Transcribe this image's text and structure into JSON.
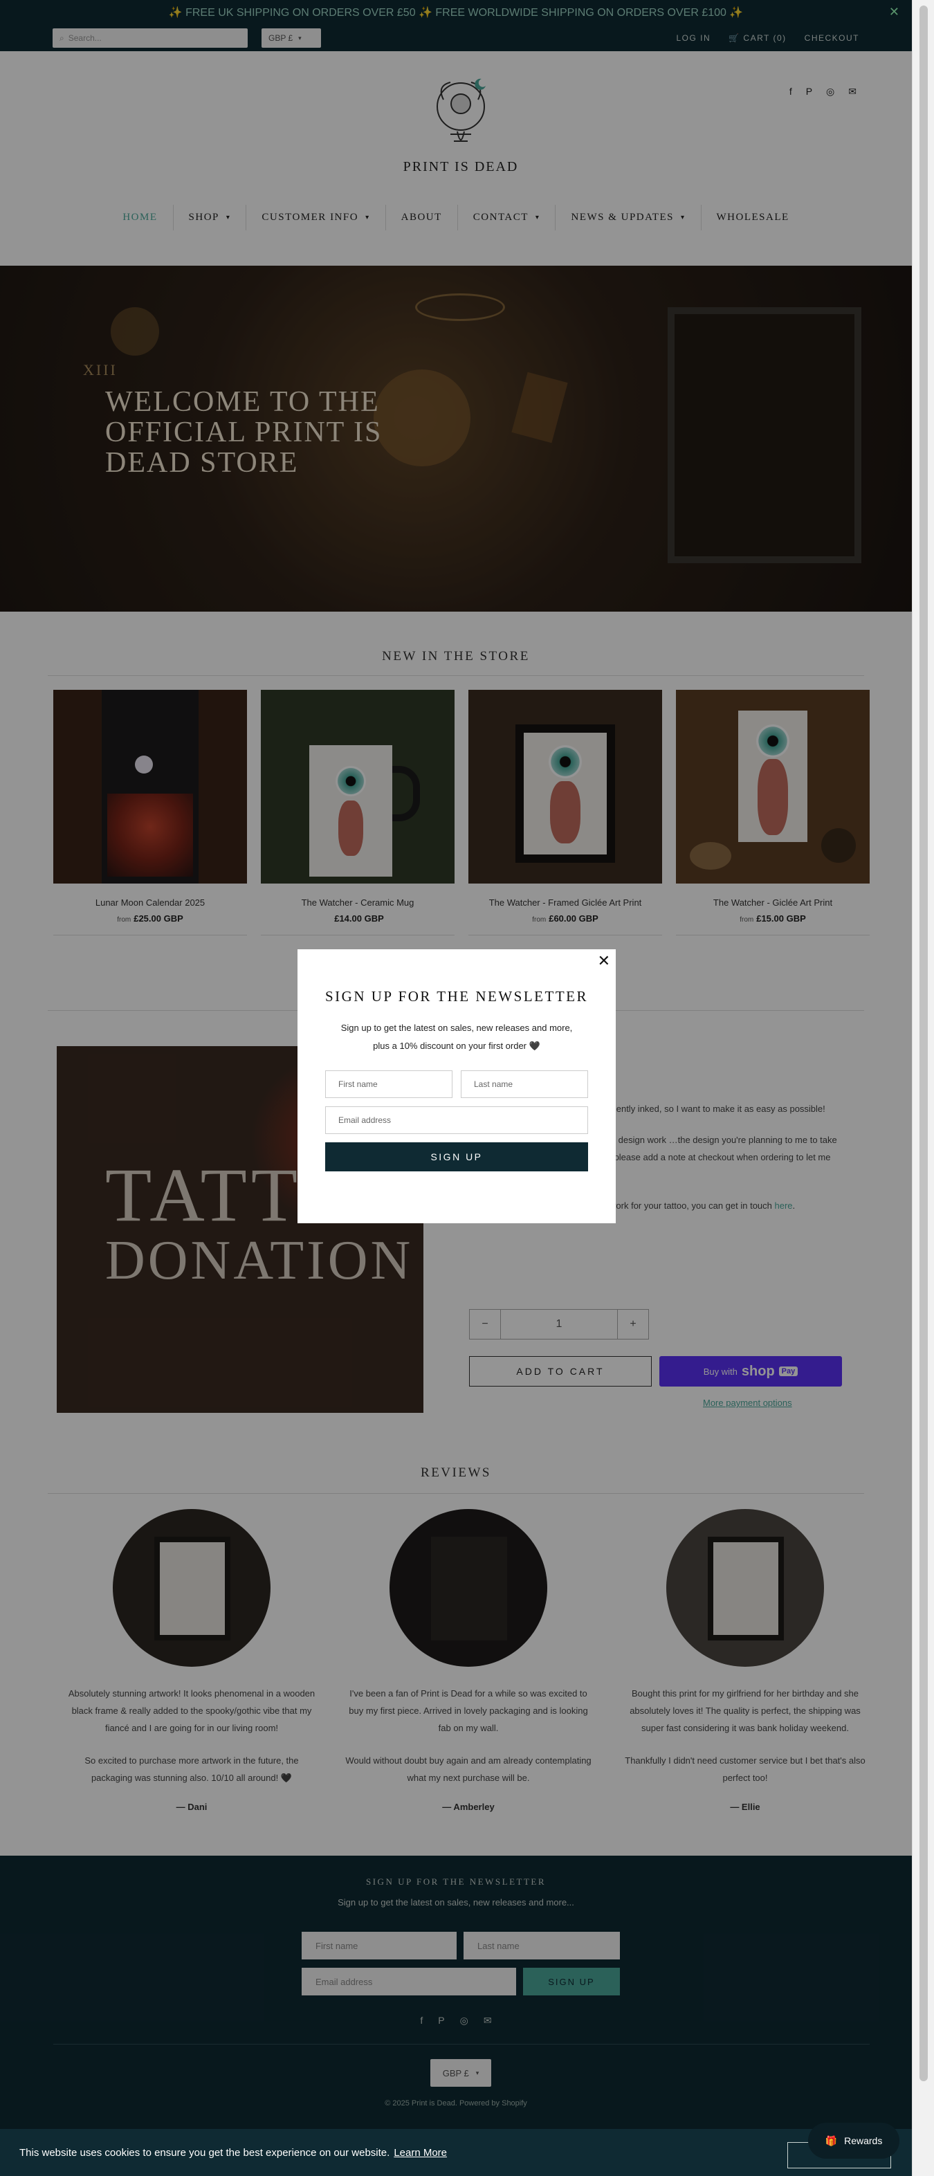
{
  "announcement": {
    "text": "✨ FREE UK SHIPPING ON ORDERS OVER £50 ✨ FREE WORLDWIDE SHIPPING ON ORDERS OVER £100 ✨",
    "close": "✕"
  },
  "topbar": {
    "search_placeholder": "Search...",
    "currency": "GBP £",
    "login": "LOG IN",
    "cart": "CART (0)",
    "checkout": "CHECKOUT"
  },
  "header": {
    "logo_text": "PRINT IS DEAD"
  },
  "nav": [
    {
      "label": "HOME"
    },
    {
      "label": "SHOP"
    },
    {
      "label": "CUSTOMER INFO"
    },
    {
      "label": "ABOUT"
    },
    {
      "label": "CONTACT"
    },
    {
      "label": "NEWS & UPDATES"
    },
    {
      "label": "WHOLESALE"
    }
  ],
  "hero": {
    "roman": "XIII",
    "title": "WELCOME TO THE OFFICIAL PRINT IS DEAD STORE"
  },
  "new_in_store": {
    "title": "NEW IN THE STORE",
    "products": [
      {
        "name": "Lunar Moon Calendar 2025",
        "from": "from",
        "price": "£25.00 GBP"
      },
      {
        "name": "The Watcher - Ceramic Mug",
        "from": "",
        "price": "£14.00 GBP"
      },
      {
        "name": "The Watcher - Framed Giclée Art Print",
        "from": "from",
        "price": "£60.00 GBP"
      },
      {
        "name": "The Watcher - Giclée Art Print",
        "from": "from",
        "price": "£15.00 GBP"
      }
    ]
  },
  "featured": {
    "image_text_1": "TATTOO",
    "image_text_2": "DONATION",
    "p1": "if it's possible to get my work permanently inked, so I want to make it as easy as possible!",
    "p2": "…and doesn't come with any custom design work …the design you're planning to me to take with you to your tattoo appointment, please add a note at checkout when ordering to let me know what design you have chosen.",
    "p3_prefix": "If you would like to discuss custom work for your tattoo, you can get in touch",
    "p3_link": "here",
    "qty_minus": "−",
    "qty_value": "1",
    "qty_plus": "+",
    "add_to_cart": "ADD TO CART",
    "shoppay_prefix": "Buy with",
    "shoppay_brand": "shop",
    "shoppay_pay": "Pay",
    "more_options": "More payment options"
  },
  "reviews": {
    "title": "REVIEWS",
    "items": [
      {
        "p1": "Absolutely stunning artwork! It looks phenomenal in a wooden black frame & really added to the spooky/gothic vibe that my fiancé and I are going for in our living room!",
        "p2": "So excited to purchase more artwork in the future, the packaging was stunning also. 10/10 all around! 🖤",
        "author": "— Dani"
      },
      {
        "p1": "I've been a fan of Print is Dead for a while so was excited to buy my first piece. Arrived in lovely packaging and is looking fab on my wall.",
        "p2": "Would without doubt buy again and am already contemplating what my next purchase will be.",
        "author": "— Amberley"
      },
      {
        "p1": "Bought this print for my girlfriend for her birthday and she absolutely loves it! The quality is perfect, the shipping was super fast considering it was bank holiday weekend.",
        "p2": "Thankfully I didn't need customer service but I bet that's also perfect too!",
        "author": "— Ellie"
      }
    ]
  },
  "footer": {
    "title": "SIGN UP FOR THE NEWSLETTER",
    "subtitle": "Sign up to get the latest on sales, new releases and more...",
    "first_name": "First name",
    "last_name": "Last name",
    "email": "Email address",
    "signup": "SIGN UP",
    "currency": "GBP £",
    "copyright": "© 2025 Print is Dead. Powered by Shopify"
  },
  "modal": {
    "close": "✕",
    "title": "SIGN UP FOR THE NEWSLETTER",
    "subtitle": "Sign up to get the latest on sales, new releases and more, plus a 10% discount on your first order 🖤",
    "first_name": "First name",
    "last_name": "Last name",
    "email": "Email address",
    "signup": "SIGN UP"
  },
  "cookie": {
    "text": "This website uses cookies to ensure you get the best experience on our website.",
    "link": "Learn More"
  },
  "rewards": {
    "label": "Rewards"
  },
  "colors": {
    "brand_dark": "#0f2a33",
    "accent": "#4aa89a",
    "shoppay": "#5a31f4"
  },
  "icons": [
    "search-icon",
    "cart-icon",
    "facebook-icon",
    "pinterest-icon",
    "instagram-icon",
    "email-icon",
    "chevron-down-icon",
    "close-icon",
    "gift-icon"
  ]
}
